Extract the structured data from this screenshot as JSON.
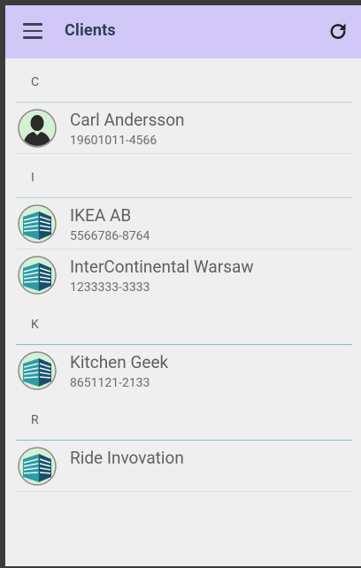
{
  "app_bar": {
    "title": "Clients",
    "menu_icon": "hamburger-menu-icon",
    "refresh_icon": "refresh-icon",
    "background": "#d2c8f7"
  },
  "sections": [
    {
      "letter": "C",
      "items": [
        {
          "name": "Carl Andersson",
          "id": "19601011-4566",
          "type": "person"
        }
      ]
    },
    {
      "letter": "I",
      "items": [
        {
          "name": "IKEA AB",
          "id": "5566786-8764",
          "type": "company"
        },
        {
          "name": "InterContinental Warsaw",
          "id": "1233333-3333",
          "type": "company"
        }
      ]
    },
    {
      "letter": "K",
      "items": [
        {
          "name": "Kitchen Geek",
          "id": "8651121-2133",
          "type": "company"
        }
      ]
    },
    {
      "letter": "R",
      "items": [
        {
          "name": "Ride Invovation",
          "id": "",
          "type": "company"
        }
      ]
    }
  ]
}
